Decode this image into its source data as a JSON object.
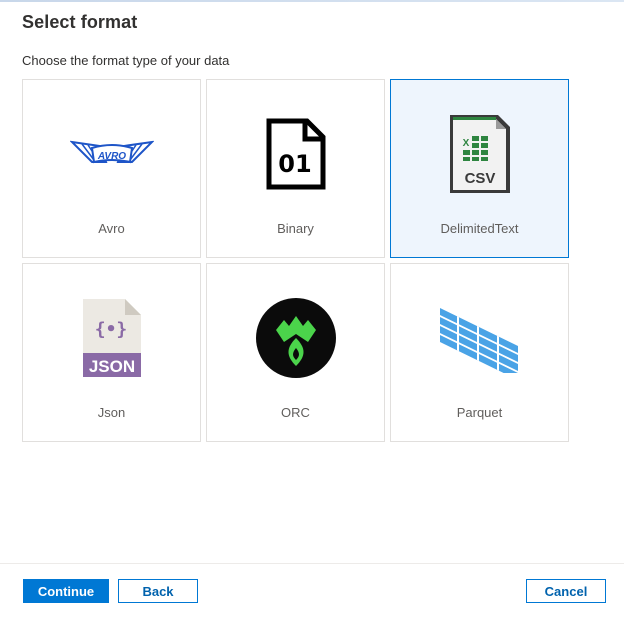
{
  "dialog": {
    "title": "Select format",
    "subtitle": "Choose the format type of your data"
  },
  "formats": [
    {
      "label": "Avro",
      "icon": "avro-logo-icon",
      "selected": false
    },
    {
      "label": "Binary",
      "icon": "binary-file-icon",
      "selected": false
    },
    {
      "label": "DelimitedText",
      "icon": "csv-file-icon",
      "selected": true
    },
    {
      "label": "Json",
      "icon": "json-file-icon",
      "selected": false
    },
    {
      "label": "ORC",
      "icon": "orc-logo-icon",
      "selected": false
    },
    {
      "label": "Parquet",
      "icon": "parquet-logo-icon",
      "selected": false
    }
  ],
  "icon_text": {
    "avro": "AVRO",
    "binary": "01",
    "csv_x": "X",
    "csv": "CSV",
    "json_braces": "{•}",
    "json": "JSON"
  },
  "footer": {
    "continue_label": "Continue",
    "back_label": "Back",
    "cancel_label": "Cancel"
  },
  "colors": {
    "accent": "#0078d4",
    "selected_tile_bg": "#eef5fd",
    "avro_blue": "#1e55c8",
    "csv_green": "#2e8540",
    "json_purple": "#8a6aa6",
    "orc_green": "#4bd44b",
    "parquet_blue": "#4aa3e6"
  }
}
